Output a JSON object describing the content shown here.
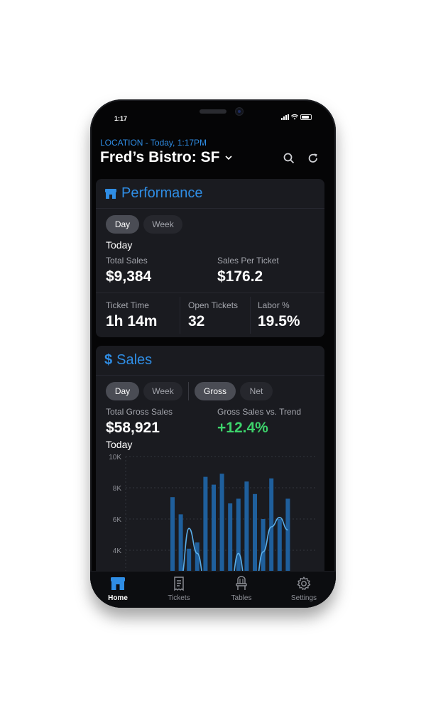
{
  "status_bar": {
    "time": "1:17"
  },
  "header": {
    "location": "LOCATION - Today, 1:17PM",
    "title": "Fred’s Bistro: SF"
  },
  "performance": {
    "title": "Performance",
    "tabs": [
      {
        "label": "Day",
        "active": true
      },
      {
        "label": "Week",
        "active": false
      }
    ],
    "period": "Today",
    "total_sales": {
      "label": "Total Sales",
      "value": "$9,384"
    },
    "sales_per_ticket": {
      "label": "Sales Per Ticket",
      "value": "$176.2"
    },
    "ticket_time": {
      "label": "Ticket Time",
      "value": "1h 14m"
    },
    "open_tickets": {
      "label": "Open Tickets",
      "value": "32"
    },
    "labor": {
      "label": "Labor %",
      "value": "19.5%"
    }
  },
  "sales": {
    "title": "Sales",
    "icon": "$",
    "period_tabs": [
      {
        "label": "Day",
        "active": true
      },
      {
        "label": "Week",
        "active": false
      }
    ],
    "type_tabs": [
      {
        "label": "Gross",
        "active": true
      },
      {
        "label": "Net",
        "active": false
      }
    ],
    "total_gross": {
      "label": "Total Gross Sales",
      "value": "$58,921",
      "period": "Today"
    },
    "vs_trend": {
      "label": "Gross Sales vs. Trend",
      "value": "+12.4%"
    }
  },
  "chart_data": {
    "type": "bar",
    "y_ticks": [
      "10K",
      "8K",
      "6K",
      "4K"
    ],
    "ylim": [
      0,
      10000
    ],
    "grid": true,
    "bar_values": [
      7400,
      6300,
      4100,
      4500,
      8700,
      8200,
      8900,
      7000,
      7300,
      8400,
      7600,
      6000,
      8600,
      6000,
      7300
    ],
    "trend_values": [
      800,
      2200,
      5400,
      3800,
      1800,
      600,
      900,
      1500,
      3800,
      1600,
      1600,
      3900,
      5500,
      6100,
      5300
    ]
  },
  "colors": {
    "accent": "#2f8de4",
    "positive": "#3dd36b",
    "bar": "#1f5f9c",
    "trend": "#5aaeea",
    "background": "#050506",
    "card": "#1a1b20"
  },
  "tabbar": {
    "items": [
      {
        "label": "Home",
        "icon": "store-icon",
        "active": true
      },
      {
        "label": "Tickets",
        "icon": "receipt-icon",
        "active": false
      },
      {
        "label": "Tables",
        "icon": "chair-icon",
        "active": false
      },
      {
        "label": "Settings",
        "icon": "gear-icon",
        "active": false
      }
    ]
  }
}
